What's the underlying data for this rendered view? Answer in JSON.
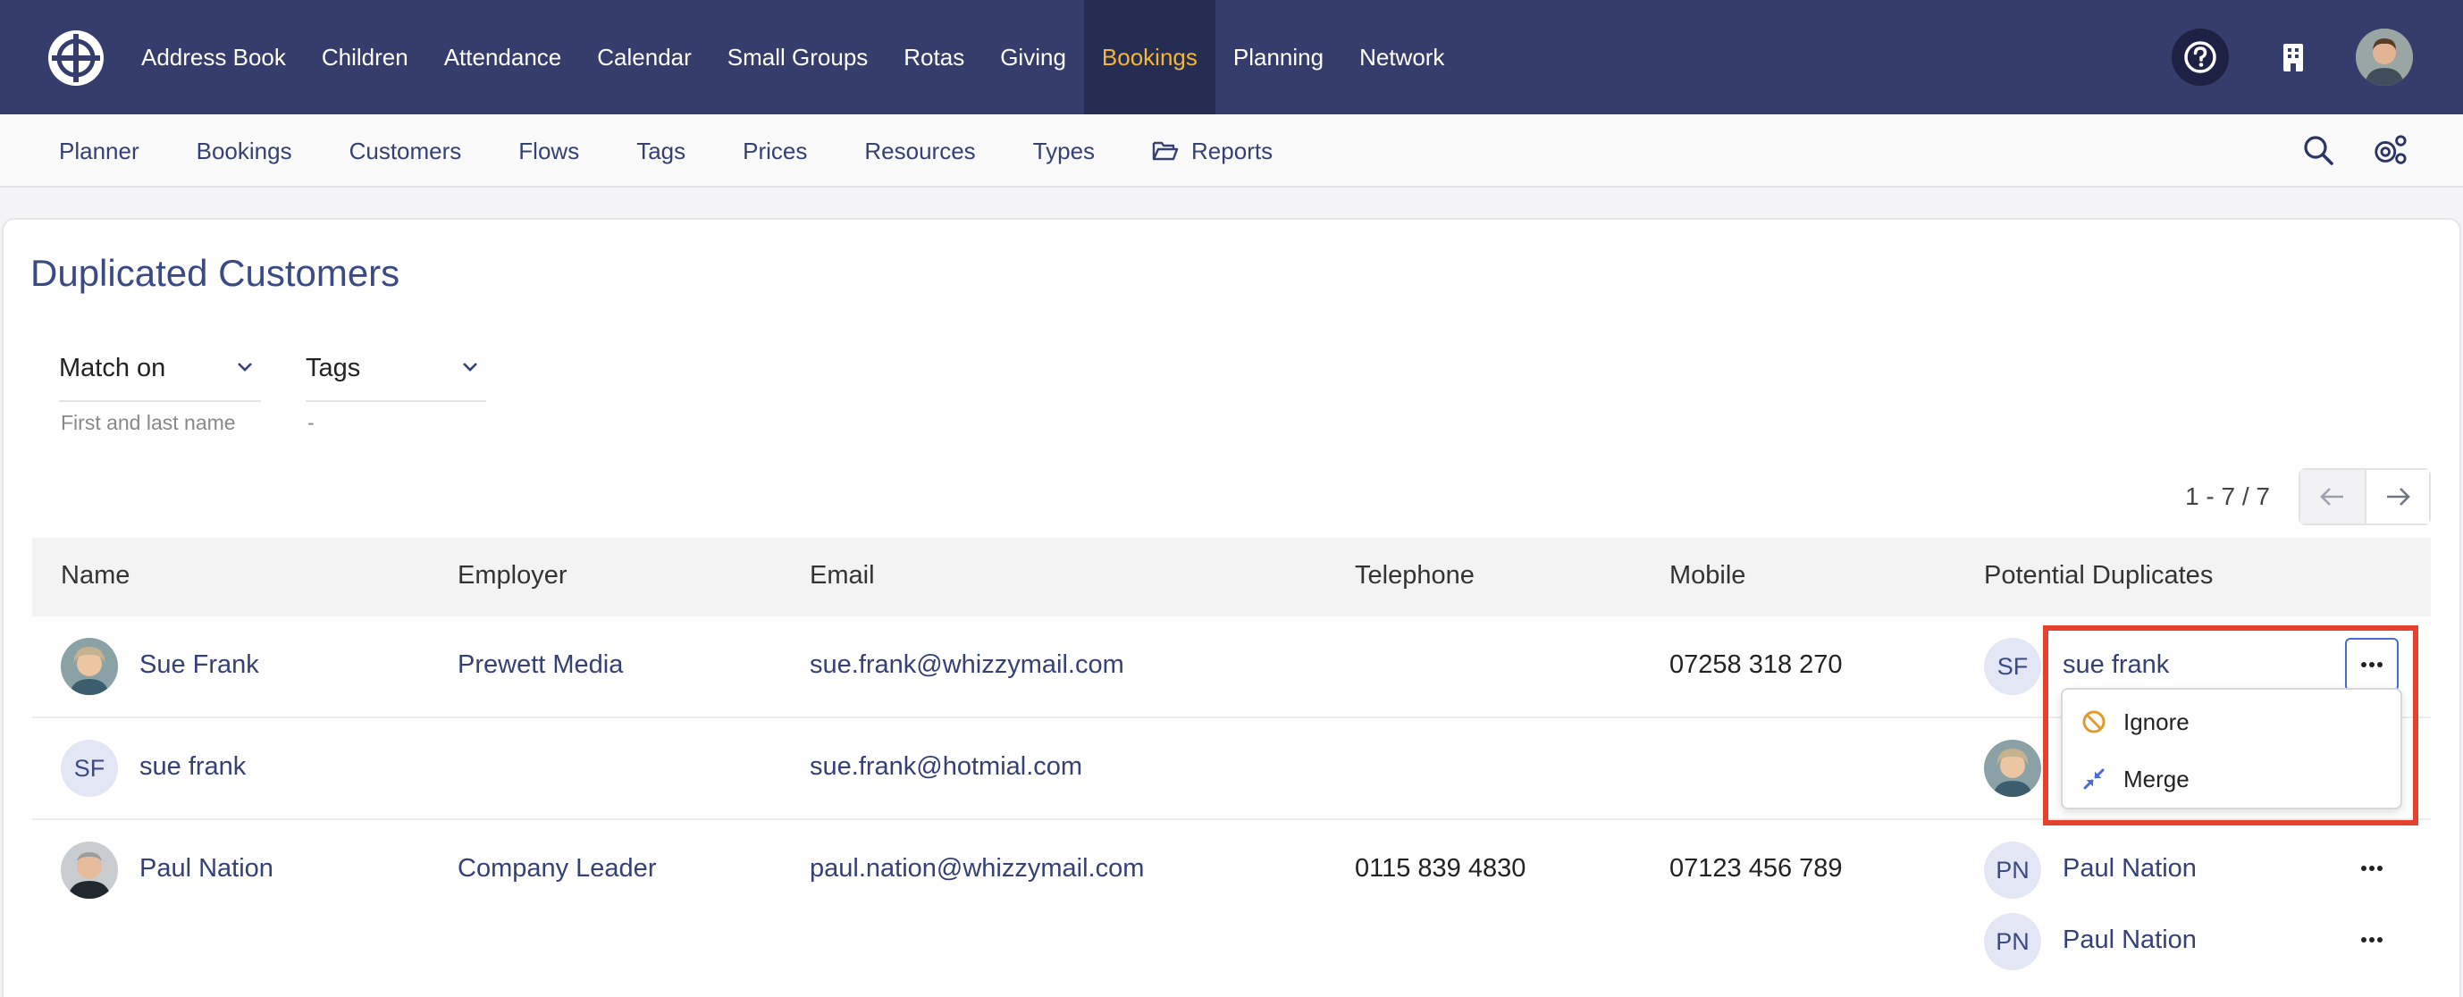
{
  "nav": {
    "items": [
      "Address Book",
      "Children",
      "Attendance",
      "Calendar",
      "Small Groups",
      "Rotas",
      "Giving",
      "Bookings",
      "Planning",
      "Network"
    ],
    "active": "Bookings",
    "icons": [
      "help-icon",
      "building-icon",
      "user-avatar"
    ]
  },
  "subnav": {
    "items": [
      "Planner",
      "Bookings",
      "Customers",
      "Flows",
      "Tags",
      "Prices",
      "Resources",
      "Types",
      "Reports"
    ],
    "icons": [
      "search-icon",
      "settings-icon"
    ]
  },
  "page": {
    "title": "Duplicated Customers"
  },
  "filters": {
    "match_on": {
      "label": "Match on",
      "value": "First and last name"
    },
    "tags": {
      "label": "Tags",
      "value": "-"
    }
  },
  "pagination": {
    "text": "1 - 7 / 7"
  },
  "table": {
    "headers": [
      "Name",
      "Employer",
      "Email",
      "Telephone",
      "Mobile",
      "Potential Duplicates"
    ],
    "rows": [
      {
        "name": "Sue Frank",
        "avatar": "photo",
        "employer": "Prewett Media",
        "email": "sue.frank@whizzymail.com",
        "telephone": "",
        "mobile": "07258 318 270",
        "duplicates": [
          {
            "initials": "SF",
            "name": "sue frank"
          }
        ]
      },
      {
        "name": "sue frank",
        "avatar": "SF",
        "employer": "",
        "email": "sue.frank@hotmial.com",
        "telephone": "",
        "mobile": "",
        "duplicates": [
          {
            "initials": "",
            "name": ""
          }
        ]
      },
      {
        "name": "Paul Nation",
        "avatar": "photo",
        "employer": "Company Leader",
        "email": "paul.nation@whizzymail.com",
        "telephone": "0115 839 4830",
        "mobile": "07123 456 789",
        "duplicates": [
          {
            "initials": "PN",
            "name": "Paul Nation"
          },
          {
            "initials": "PN",
            "name": "Paul Nation"
          }
        ]
      }
    ]
  },
  "dropdown_menu": {
    "items": [
      {
        "label": "Ignore",
        "icon": "ignore-icon"
      },
      {
        "label": "Merge",
        "icon": "merge-icon"
      }
    ]
  },
  "colors": {
    "nav_bg": "#343d6b",
    "active_nav": "#f2b73a",
    "link": "#354075",
    "highlight": "#e4422d"
  }
}
